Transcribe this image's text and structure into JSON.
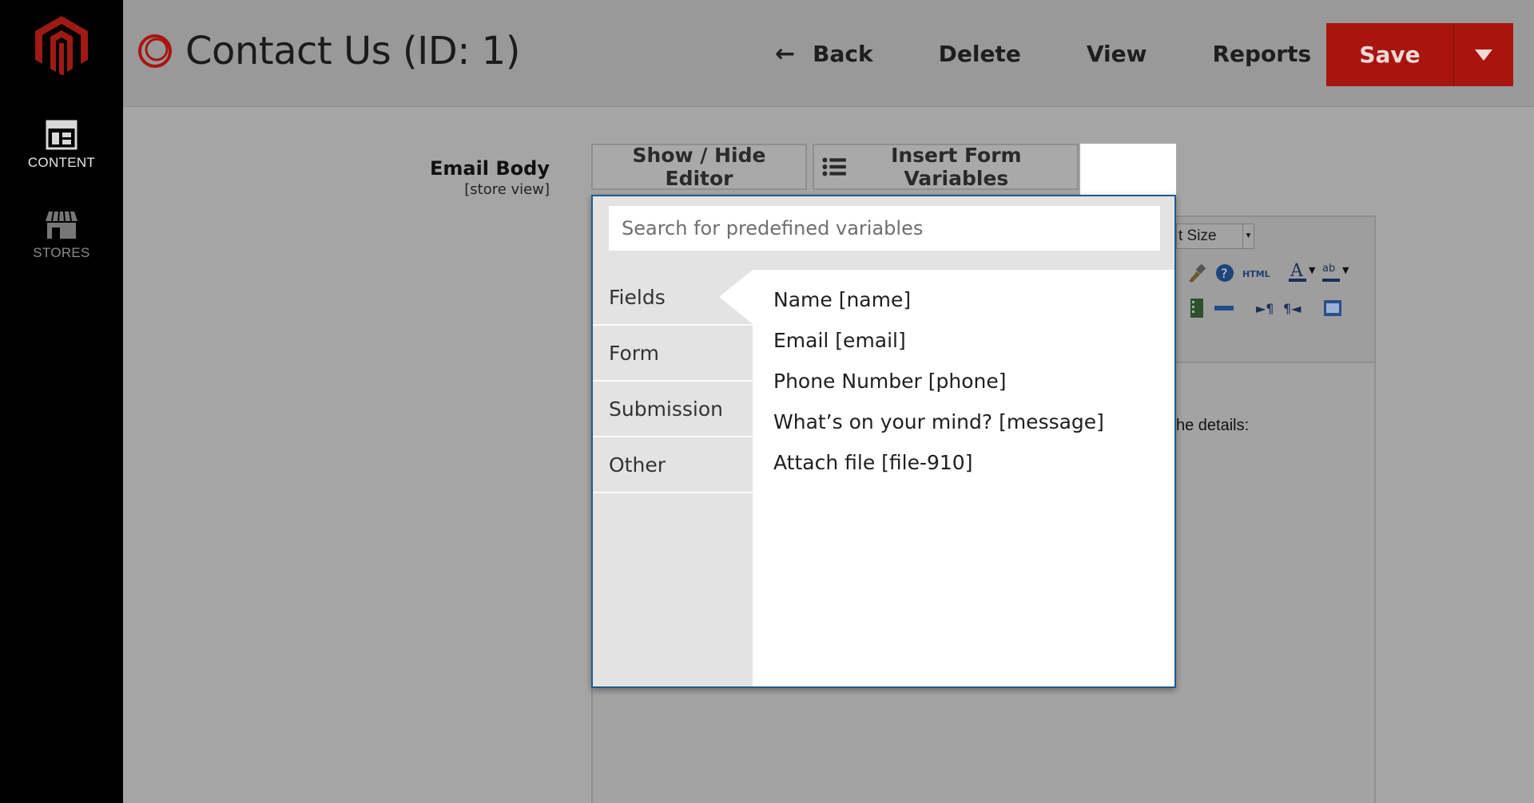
{
  "sidebar": {
    "items": [
      {
        "label": "CONTENT",
        "icon": "layout-icon",
        "state": "active"
      },
      {
        "label": "STORES",
        "icon": "store-icon",
        "state": "inactive"
      }
    ]
  },
  "header": {
    "title": "Contact Us (ID: 1)",
    "actions": {
      "back": "Back",
      "delete": "Delete",
      "view": "View",
      "reports": "Reports",
      "save": "Save"
    },
    "colors": {
      "save_bg": "#a8150f",
      "logo": "#b3140f"
    }
  },
  "field": {
    "label": "Email Body",
    "scope": "[store view]",
    "show_hide_editor": "Show / Hide Editor",
    "insert_form_variables": "Insert Form Variables"
  },
  "editor": {
    "font_size_label": "t Size",
    "visible_text": "he details:"
  },
  "variables_panel": {
    "search_placeholder": "Search for predefined variables",
    "tabs": [
      {
        "label": "Fields",
        "active": true
      },
      {
        "label": "Form",
        "active": false
      },
      {
        "label": "Submission",
        "active": false
      },
      {
        "label": "Other",
        "active": false
      }
    ],
    "items": [
      "Name [name]",
      "Email [email]",
      "Phone Number [phone]",
      "What’s on your mind? [message]",
      "Attach file [file-910]"
    ]
  }
}
